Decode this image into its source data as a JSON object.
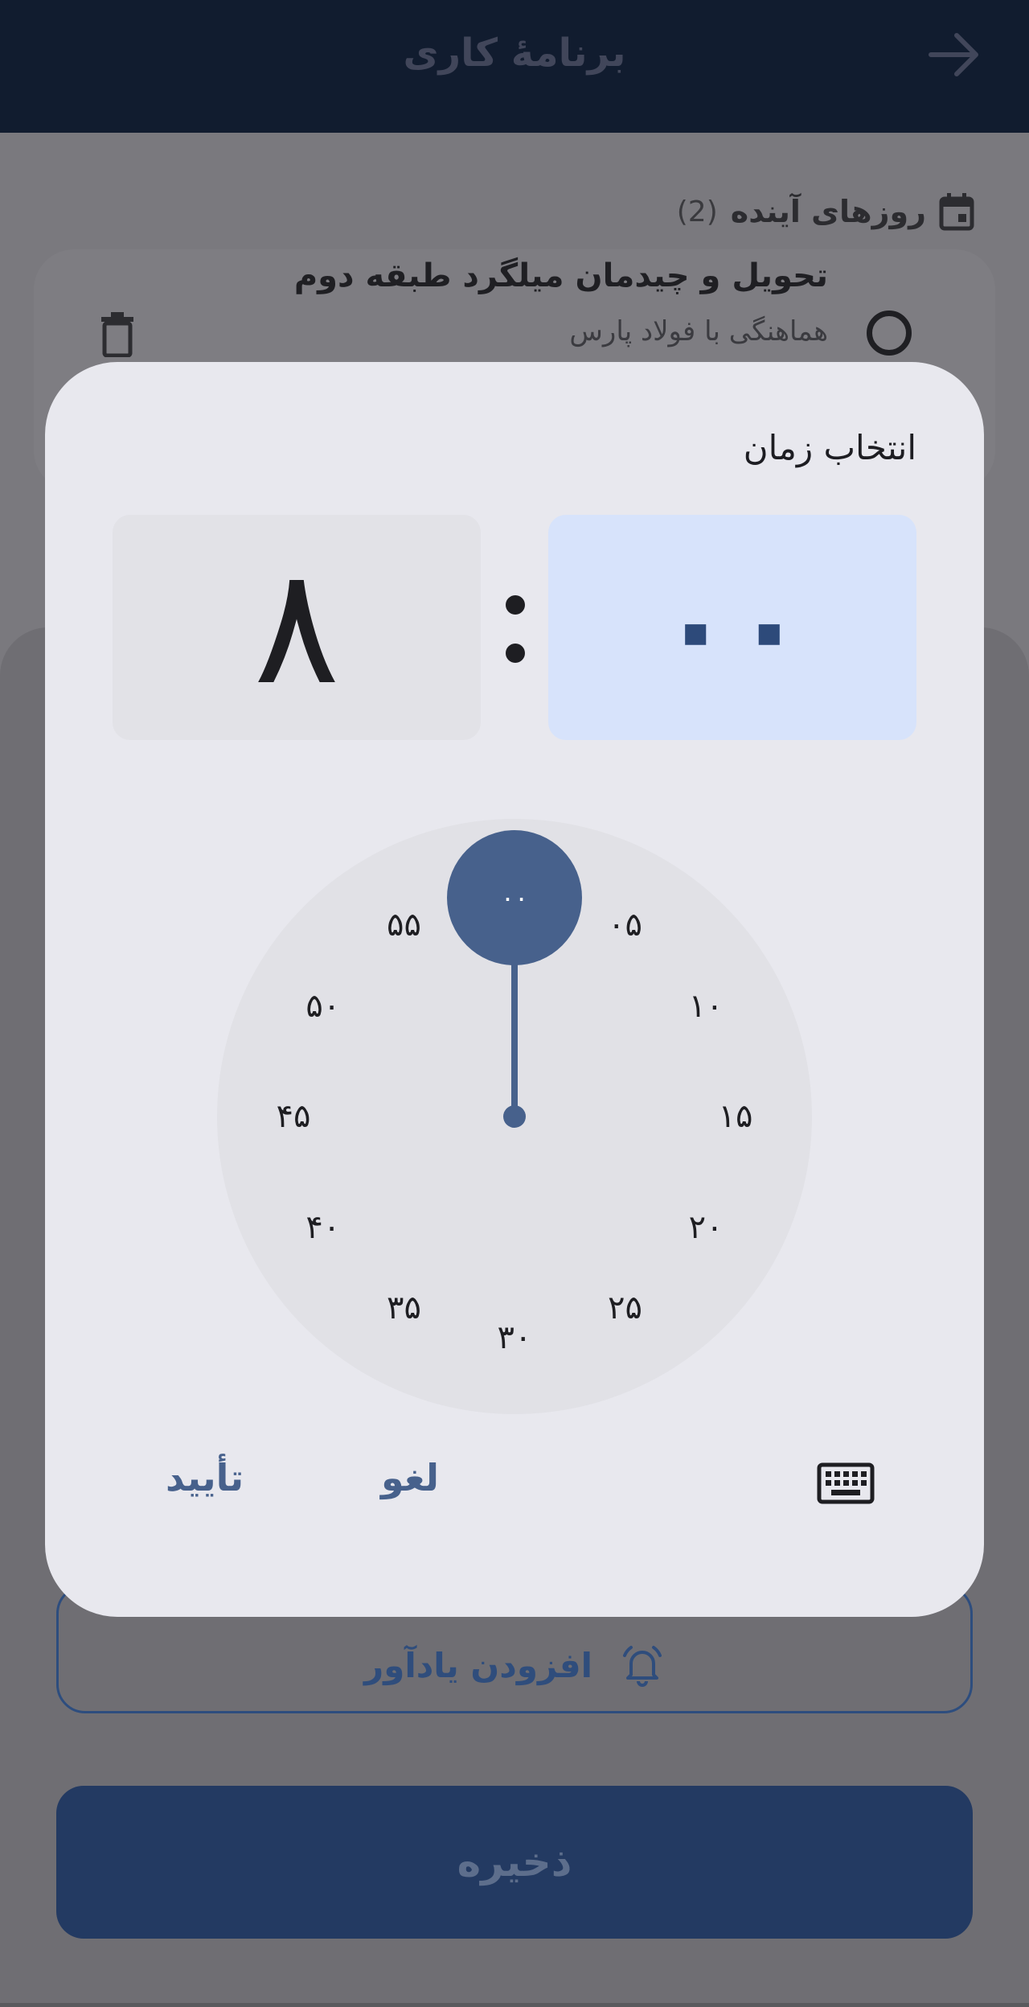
{
  "appbar": {
    "title": "برنامهٔ کاری",
    "back_icon": "arrow-right-icon"
  },
  "section": {
    "title": "روزهای آینده",
    "count": "(2)",
    "icon": "calendar-icon"
  },
  "task": {
    "title": "تحویل و چیدمان میلگرد طبقه دوم",
    "subtitle": "هماهنگی با فولاد پارس"
  },
  "sheet": {
    "reminder_label": "افزودن یادآور",
    "save_label": "ذخیره"
  },
  "dialog": {
    "title": "انتخاب زمان",
    "hour": "۸",
    "minute": "۰۰",
    "selected_marker": "۰۰",
    "dial_numbers": [
      "۰۰",
      "۰۵",
      "۱۰",
      "۱۵",
      "۲۰",
      "۲۵",
      "۳۰",
      "۳۵",
      "۴۰",
      "۴۵",
      "۵۰",
      "۵۵"
    ],
    "cancel_label": "لغو",
    "ok_label": "تأیید"
  },
  "colors": {
    "accent": "#47618c",
    "minute_bg": "#d7e3fb",
    "dialog_bg": "#e8e8ee"
  }
}
